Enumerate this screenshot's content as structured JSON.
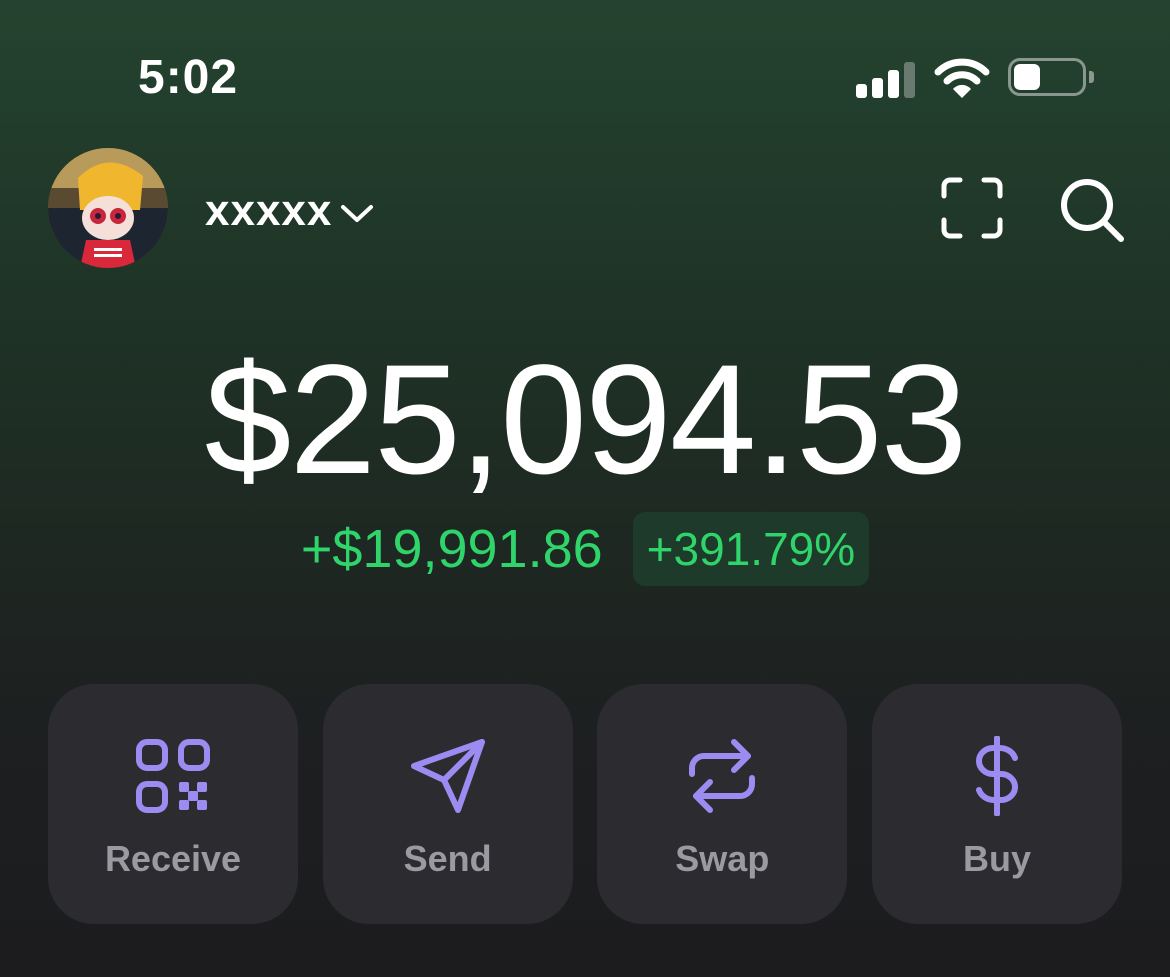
{
  "status_bar": {
    "time": "5:02",
    "signal_icon": "cellular-signal-icon",
    "wifi_icon": "wifi-icon",
    "battery_icon": "battery-icon",
    "battery_level": 0.4
  },
  "header": {
    "account_name": "xxxxx",
    "dropdown_icon": "chevron-down-icon",
    "scan_icon": "scan-icon",
    "search_icon": "search-icon"
  },
  "portfolio": {
    "balance": "$25,094.53",
    "change_amount": "+$19,991.86",
    "change_percent": "+391.79%"
  },
  "actions": [
    {
      "label": "Receive",
      "icon": "qr-code-icon"
    },
    {
      "label": "Send",
      "icon": "send-icon"
    },
    {
      "label": "Swap",
      "icon": "swap-icon"
    },
    {
      "label": "Buy",
      "icon": "dollar-icon"
    }
  ],
  "colors": {
    "accent": "#9c8cf2",
    "positive": "#2fd46b",
    "positive_bg": "#1d3a2a",
    "card_bg": "#2b2b30",
    "label_gray": "#9a9aa0"
  }
}
